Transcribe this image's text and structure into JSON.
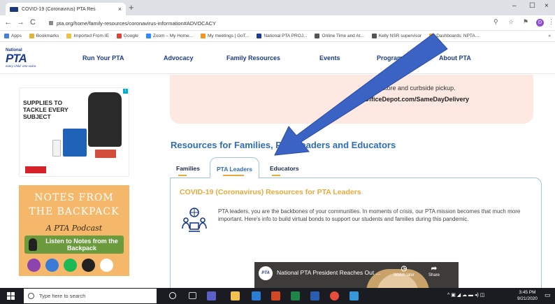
{
  "browser": {
    "tab_title": "COVID-19 (Coronavirus) PTA Res",
    "tab_close": "×",
    "new_tab": "+",
    "win_min": "–",
    "win_max": "☐",
    "win_close": "×",
    "back": "←",
    "forward": "→",
    "reload": "C",
    "url": "pta.org/home/family-resources/coronavirus-information#ADVOCACY",
    "zoom": "⚲",
    "star": "☆",
    "ext": "⚑",
    "profile_initial": "D",
    "menu": "⋮",
    "bookmarks": [
      {
        "label": "Apps",
        "color": "#4a7fd6"
      },
      {
        "label": "Bookmarks",
        "color": "#e0b43a"
      },
      {
        "label": "Imported From IE",
        "color": "#f0c040"
      },
      {
        "label": "Google",
        "color": "#db4437"
      },
      {
        "label": "Zoom – My Home...",
        "color": "#2d8cff"
      },
      {
        "label": "My meetings | GoT...",
        "color": "#f7931e"
      },
      {
        "label": "National PTA PROJ...",
        "color": "#1d3c8f"
      },
      {
        "label": "Online Time and At...",
        "color": "#555555"
      },
      {
        "label": "Kelly NSR supervisor",
        "color": "#555555"
      },
      {
        "label": "Dashboards: NPTA...",
        "color": "#f9a825"
      }
    ],
    "bookmarks_more": "»"
  },
  "site": {
    "logo_national": "National",
    "logo_pta": "PTA",
    "logo_tagline": "every child. one voice.",
    "nav": [
      "Run Your PTA",
      "Advocacy",
      "Family Resources",
      "Events",
      "Programs",
      "About PTA"
    ]
  },
  "ads": {
    "supplies_title": "SUPPLIES TO TACKLE EVERY SUBJECT",
    "notes_line1": "NOTES FROM",
    "notes_line2": "THE BACKPACK",
    "notes_sub": "A PTA Podcast",
    "notes_listen": "Listen to Notes from the Backpack"
  },
  "promo": {
    "line1": "ree in-store and curbside pickup.",
    "line2": "OfficeDepot.com/SameDayDelivery"
  },
  "resources": {
    "title": "Resources for Families, PTA Leaders and Educators",
    "tabs": [
      "Families",
      "PTA Leaders",
      "Educators"
    ],
    "panel_title": "COVID-19 (Coronavirus) Resources for PTA Leaders",
    "panel_text": "PTA leaders, you are the backbones of your communities. In moments of crisis, our PTA mission becomes that much more important. Here's info to build virtual bonds to support our students and families during this pandemic.",
    "video_logo": "PTA",
    "video_title": "National PTA President Reaches Out ...",
    "watch_later": "Watch later",
    "share": "Share",
    "watch_icon": "◷",
    "share_icon": "➦"
  },
  "taskbar": {
    "search_placeholder": "Type here to search",
    "tray_icons": "^ ▣ ◢ ☁ ▬ ◂) ◫",
    "time": "3:45 PM",
    "date": "9/21/2020"
  },
  "colors": {
    "brand_blue": "#1d3c8f",
    "section_blue": "#2f6db5",
    "accent_orange": "#e8a93b",
    "arrow_blue": "#3a63c4"
  }
}
